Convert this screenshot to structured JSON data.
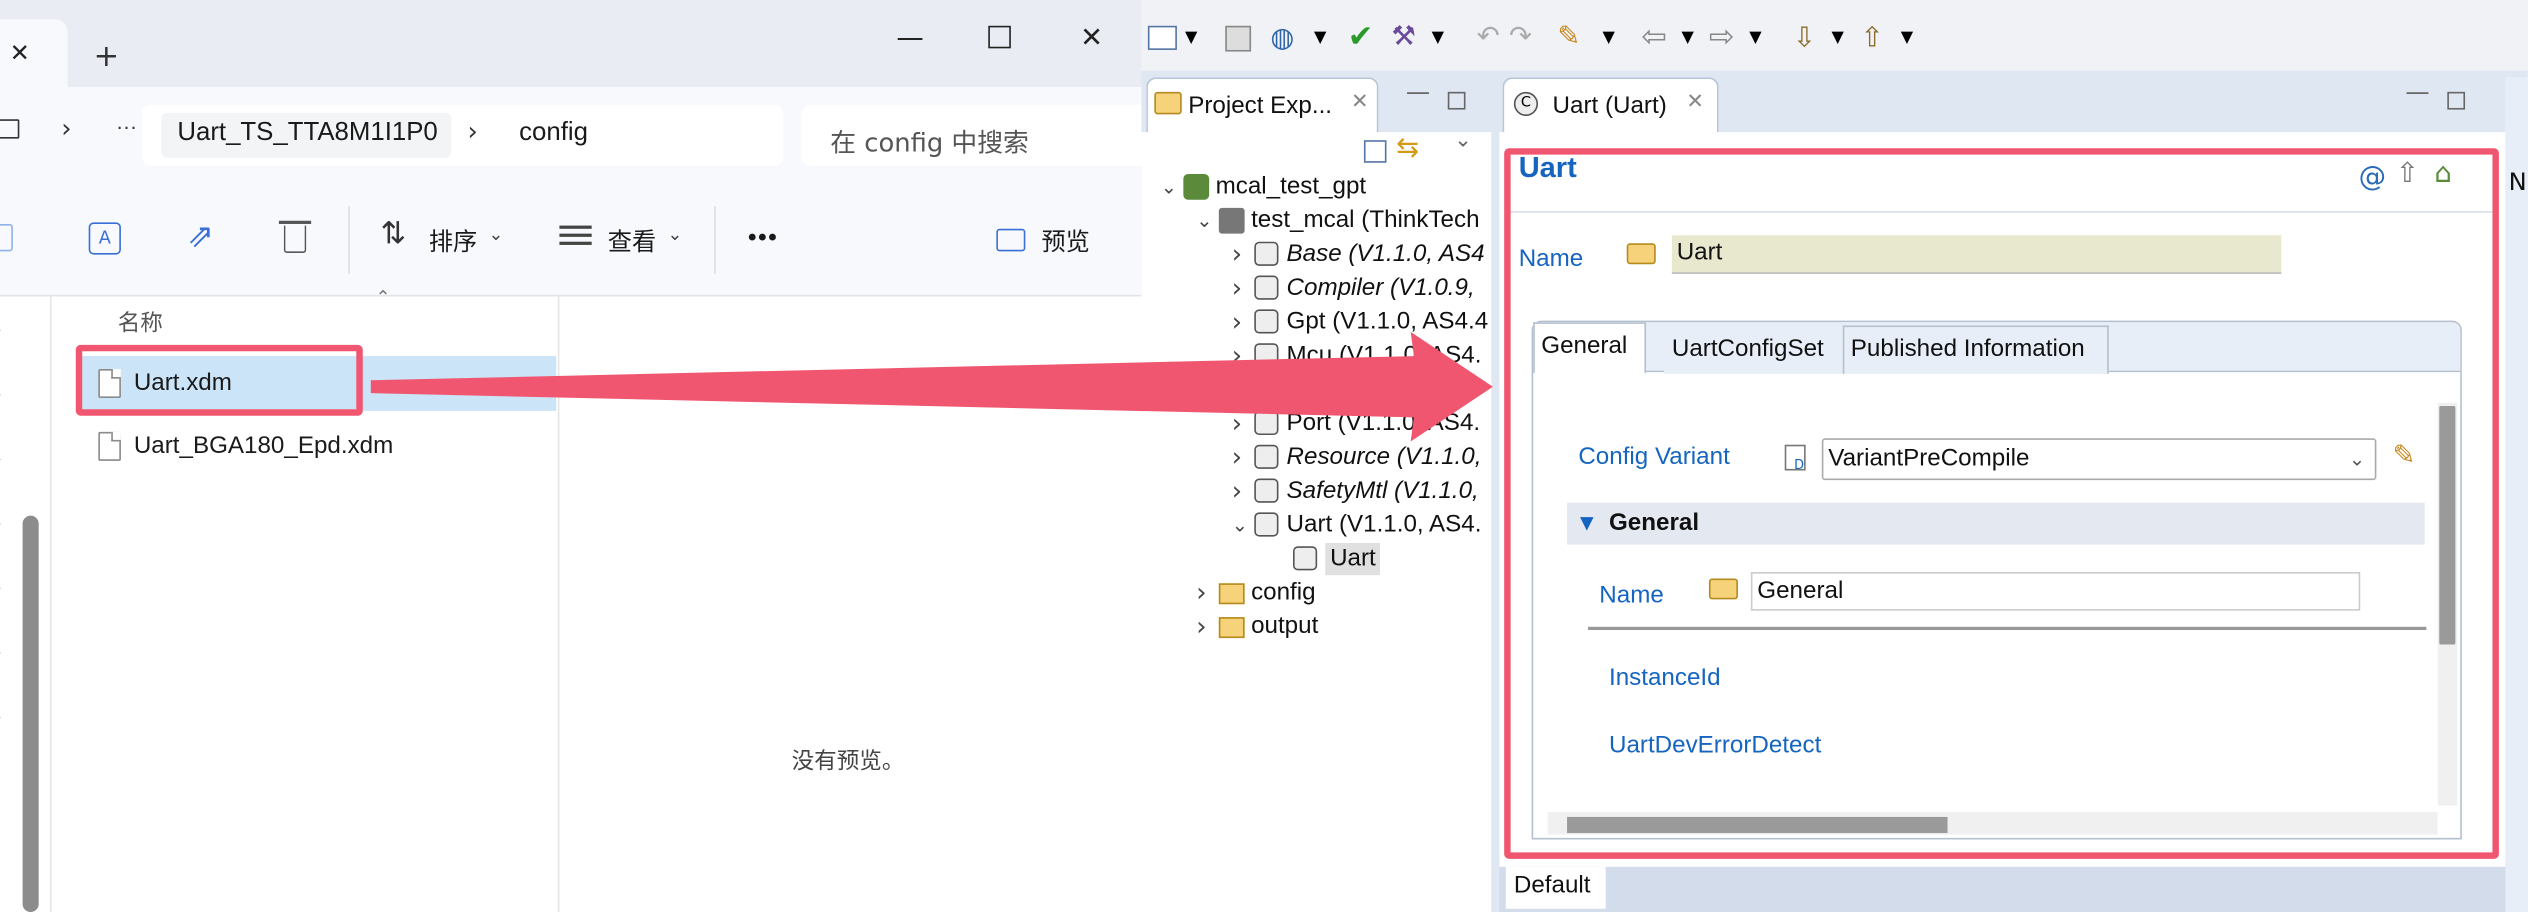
{
  "explorer": {
    "breadcrumb": [
      "Uart_TS_TTA8M1I1P0",
      "config"
    ],
    "breadcrumb_more": "···",
    "search_placeholder": "在 config 中搜索",
    "toolbar": {
      "sort": "排序",
      "view": "查看",
      "more": "•••",
      "preview": "预览"
    },
    "column_name": "名称",
    "files": [
      "Uart.xdm",
      "Uart_BGA180_Epd.xdm"
    ],
    "no_preview": "没有预览。"
  },
  "eclipse": {
    "project_explorer_tab": "Project Exp...",
    "editor_tab": "Uart (Uart)",
    "tree": [
      {
        "label": "mcal_test_gpt",
        "level": 0,
        "expanded": true,
        "italic": false
      },
      {
        "label": "test_mcal (ThinkTech",
        "level": 1,
        "expanded": true,
        "italic": false
      },
      {
        "label": "Base (V1.1.0, AS4",
        "level": 2,
        "expanded": false,
        "italic": true
      },
      {
        "label": "Compiler (V1.0.9,",
        "level": 2,
        "expanded": false,
        "italic": true
      },
      {
        "label": "Gpt (V1.1.0, AS4.4",
        "level": 2,
        "expanded": false,
        "italic": false
      },
      {
        "label": "Mcu (V1.1.0, AS4.",
        "level": 2,
        "expanded": false,
        "italic": false
      },
      {
        "label": "...0, /",
        "level": 2,
        "expanded": false,
        "italic": false
      },
      {
        "label": "Port (V1.1.0, AS4.",
        "level": 2,
        "expanded": false,
        "italic": false
      },
      {
        "label": "Resource (V1.1.0,",
        "level": 2,
        "expanded": false,
        "italic": true
      },
      {
        "label": "SafetyMtl (V1.1.0,",
        "level": 2,
        "expanded": false,
        "italic": true
      },
      {
        "label": "Uart (V1.1.0, AS4.",
        "level": 2,
        "expanded": true,
        "italic": false
      },
      {
        "label": "Uart",
        "level": 3,
        "expanded": null,
        "italic": false
      },
      {
        "label": "config",
        "level": 1,
        "expanded": false,
        "italic": false
      },
      {
        "label": "output",
        "level": 1,
        "expanded": false,
        "italic": false
      }
    ],
    "editor": {
      "title": "Uart",
      "name_label": "Name",
      "name_value": "Uart",
      "tabs": [
        "General",
        "UartConfigSet",
        "Published Information"
      ],
      "config_variant_label": "Config Variant",
      "config_variant_value": "VariantPreCompile",
      "section_title": "General",
      "section_name_label": "Name",
      "section_name_value": "General",
      "params": [
        "InstanceId",
        "UartDevErrorDetect"
      ],
      "bottom_tab": "Default"
    }
  },
  "colors": {
    "accent": "#1565c0",
    "highlight_red": "#f0566f",
    "selection": "#cce4f7"
  }
}
